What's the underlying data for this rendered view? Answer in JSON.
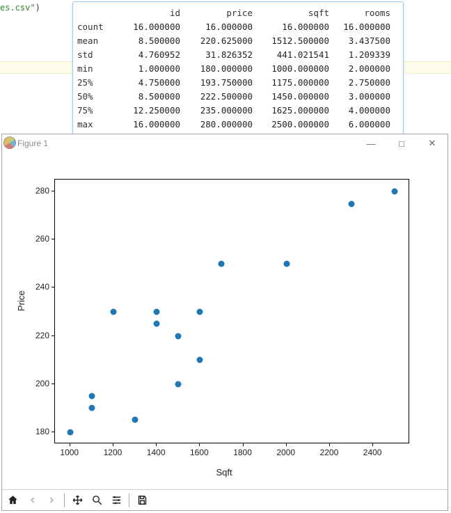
{
  "code_fragment": {
    "string": "es.csv\"",
    "paren": ")"
  },
  "stats": {
    "headers": [
      "id",
      "price",
      "sqft",
      "rooms"
    ],
    "rows": [
      {
        "label": "count",
        "cells": [
          "16.000000",
          "16.000000",
          "16.000000",
          "16.000000"
        ]
      },
      {
        "label": "mean",
        "cells": [
          "8.500000",
          "220.625000",
          "1512.500000",
          "3.437500"
        ]
      },
      {
        "label": "std",
        "cells": [
          "4.760952",
          "31.826352",
          "441.021541",
          "1.209339"
        ]
      },
      {
        "label": "min",
        "cells": [
          "1.000000",
          "180.000000",
          "1000.000000",
          "2.000000"
        ]
      },
      {
        "label": "25%",
        "cells": [
          "4.750000",
          "193.750000",
          "1175.000000",
          "2.750000"
        ]
      },
      {
        "label": "50%",
        "cells": [
          "8.500000",
          "222.500000",
          "1450.000000",
          "3.000000"
        ]
      },
      {
        "label": "75%",
        "cells": [
          "12.250000",
          "235.000000",
          "1625.000000",
          "4.000000"
        ]
      },
      {
        "label": "max",
        "cells": [
          "16.000000",
          "280.000000",
          "2500.000000",
          "6.000000"
        ]
      }
    ]
  },
  "figure": {
    "title": "Figure 1",
    "window_buttons": {
      "min": "—",
      "max": "□",
      "close": "✕"
    }
  },
  "chart_data": {
    "type": "scatter",
    "title": "",
    "xlabel": "Sqft",
    "ylabel": "Price",
    "xlim": [
      930,
      2570
    ],
    "ylim": [
      175,
      285
    ],
    "xticks": [
      1000,
      1200,
      1400,
      1600,
      1800,
      2000,
      2200,
      2400
    ],
    "yticks": [
      180,
      200,
      220,
      240,
      260,
      280
    ],
    "points": [
      {
        "x": 1000,
        "y": 180
      },
      {
        "x": 1100,
        "y": 190
      },
      {
        "x": 1100,
        "y": 195
      },
      {
        "x": 1200,
        "y": 230
      },
      {
        "x": 1300,
        "y": 185
      },
      {
        "x": 1400,
        "y": 225
      },
      {
        "x": 1400,
        "y": 230
      },
      {
        "x": 1500,
        "y": 200
      },
      {
        "x": 1500,
        "y": 220
      },
      {
        "x": 1600,
        "y": 210
      },
      {
        "x": 1600,
        "y": 230
      },
      {
        "x": 1700,
        "y": 250
      },
      {
        "x": 2000,
        "y": 250
      },
      {
        "x": 2300,
        "y": 275
      },
      {
        "x": 2500,
        "y": 280
      }
    ],
    "color": "#1f77b4"
  },
  "toolbar": [
    "home",
    "back",
    "forward",
    "pan",
    "zoom",
    "configure",
    "save"
  ]
}
